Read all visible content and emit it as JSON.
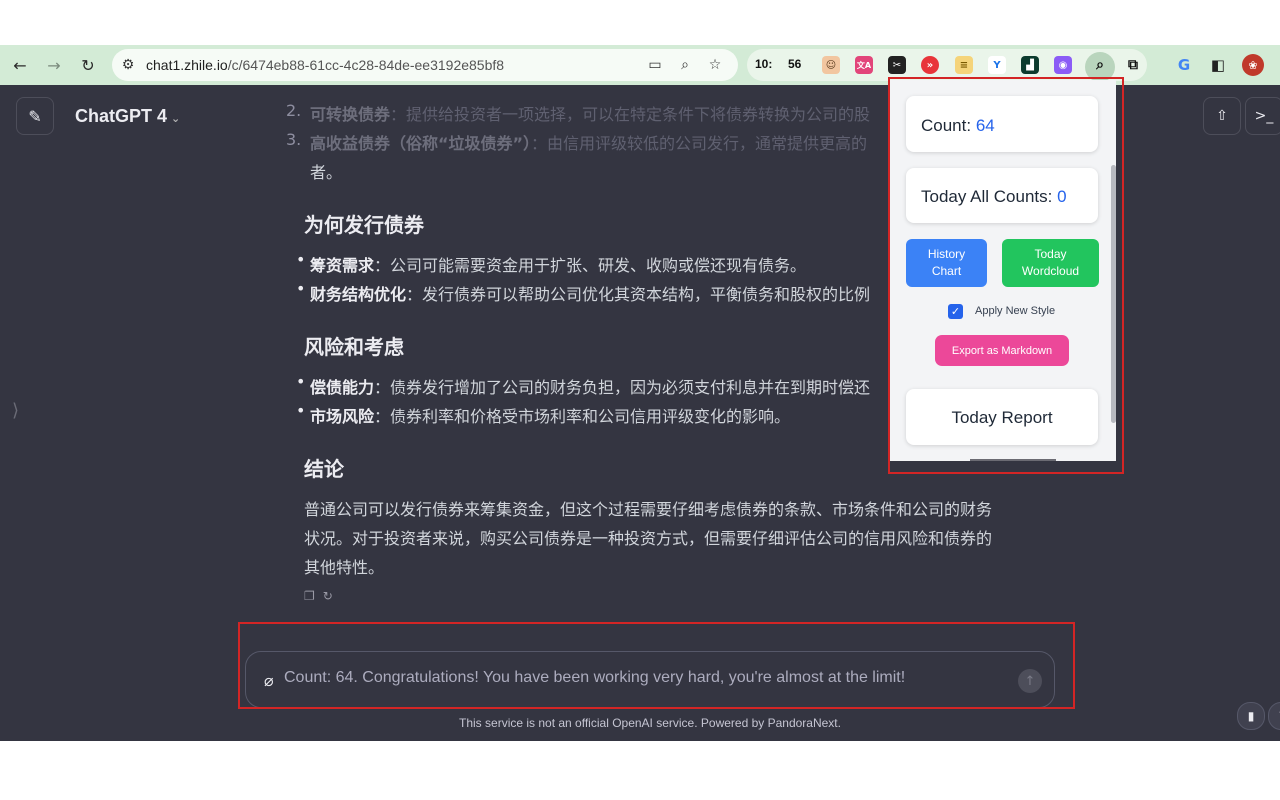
{
  "browser": {
    "url_host": "chat1.zhile.io",
    "url_path": "/c/6474eb88-61cc-4c28-84de-ee3192e85bf8",
    "ext_counter_a": "10:",
    "ext_counter_b": "56",
    "ext_translate_text": "文A",
    "nav_icons": [
      "back-arrow-icon",
      "forward-arrow-icon",
      "reload-icon"
    ],
    "omnibox_icons": [
      "site-settings-icon",
      "install-app-icon",
      "zoom-icon",
      "bookmark-star-icon"
    ],
    "toolbar_icons": [
      "extensions-puzzle-icon",
      "google-icon",
      "side-panel-icon",
      "profile-avatar-icon"
    ]
  },
  "app": {
    "model_name": "ChatGPT 4",
    "header_icons": [
      "new-chat-icon",
      "share-icon",
      "terminal-icon"
    ]
  },
  "article": {
    "item2_num": "2.",
    "item2_bold": "可转换债券",
    "item2_text": "：提供给投资者一项选择，可以在特定条件下将债券转换为公司的股",
    "item3_num": "3.",
    "item3_bold": "高收益债券（俗称“垃圾债券”）",
    "item3_text": "：由信用评级较低的公司发行，通常提供更高的",
    "item3_cont": "者。",
    "h_why": "为何发行债券",
    "why_1_bold": "筹资需求",
    "why_1_text": "：公司可能需要资金用于扩张、研发、收购或偿还现有债务。",
    "why_2_bold": "财务结构优化",
    "why_2_text": "：发行债券可以帮助公司优化其资本结构，平衡债务和股权的比例",
    "h_risk": "风险和考虑",
    "risk_1_bold": "偿债能力",
    "risk_1_text": "：债券发行增加了公司的财务负担，因为必须支付利息并在到期时偿还",
    "risk_2_bold": "市场风险",
    "risk_2_text": "：债券利率和价格受市场利率和公司信用评级变化的影响。",
    "h_conclusion": "结论",
    "conclusion_1": "普通公司可以发行债券来筹集资金，但这个过程需要仔细考虑债券的条款、市场条件和公司的财务",
    "conclusion_2": "状况。对于投资者来说，购买公司债券是一种投资方式，但需要仔细评估公司的信用风险和债券的",
    "conclusion_3": "其他特性。"
  },
  "composer": {
    "text": "Count: 64. Congratulations! You have been working very hard, you're almost at the limit!",
    "footer": "This service is not an official OpenAI service. Powered by PandoraNext."
  },
  "popup": {
    "count_label": "Count: ",
    "count_value": "64",
    "today_label": "Today All Counts: ",
    "today_value": "0",
    "history_btn_line1": "History",
    "history_btn_line2": "Chart",
    "wordcloud_btn_line1": "Today",
    "wordcloud_btn_line2": "Wordcloud",
    "apply_style_label": "Apply New Style",
    "apply_style_checked": true,
    "export_btn": "Export as Markdown",
    "today_report_btn": "Today Report"
  },
  "colors": {
    "chat_bg": "#343541",
    "chrome_bar": "#d3ebd6",
    "count_blue": "#2563eb",
    "history_btn": "#3b82f6",
    "wordcloud_btn": "#22c55e",
    "export_btn": "#ec4899",
    "highlight_red": "#d32525"
  }
}
